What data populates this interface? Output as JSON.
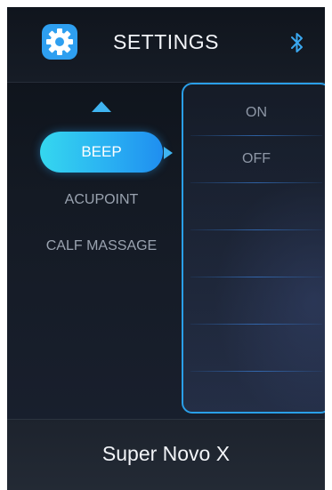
{
  "header": {
    "title": "SETTINGS",
    "settings_icon": "gear-icon",
    "bluetooth_icon": "bluetooth-icon"
  },
  "menu": {
    "items": [
      {
        "label": "BEEP",
        "selected": true
      },
      {
        "label": "ACUPOINT",
        "selected": false
      },
      {
        "label": "CALF MASSAGE",
        "selected": false
      }
    ]
  },
  "options": {
    "items": [
      "ON",
      "OFF"
    ]
  },
  "footer": {
    "model_name": "Super Novo X"
  },
  "colors": {
    "accent": "#2ab1f2",
    "panel_border": "#2a9fe8",
    "background": "#141a24"
  }
}
